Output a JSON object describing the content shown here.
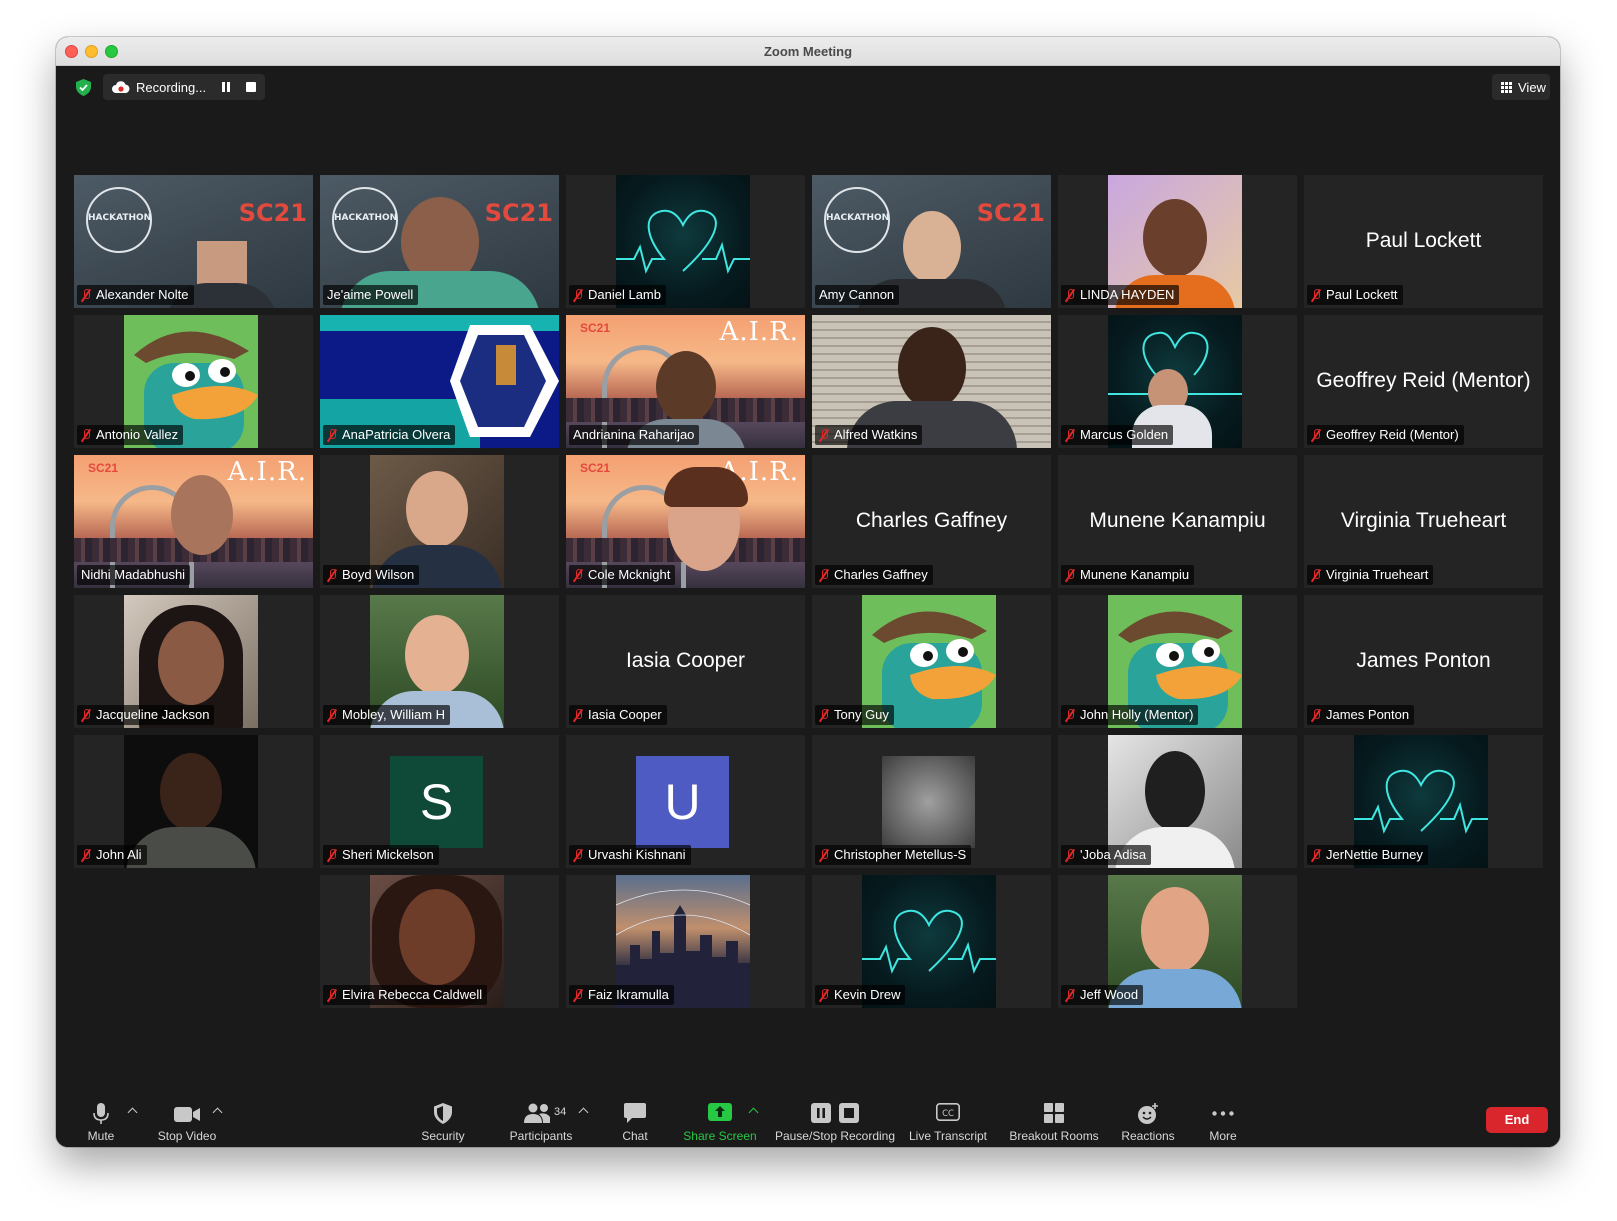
{
  "window": {
    "title": "Zoom Meeting"
  },
  "topbar": {
    "recording_label": "Recording...",
    "view_label": "View"
  },
  "participants": [
    {
      "name": "Alexander Nolte"
    },
    {
      "name": "Je'aime Powell"
    },
    {
      "name": "Daniel Lamb"
    },
    {
      "name": "Amy Cannon"
    },
    {
      "name": "LINDA HAYDEN"
    },
    {
      "name": "Paul Lockett",
      "display": "Paul Lockett"
    },
    {
      "name": "Antonio Vallez"
    },
    {
      "name": "AnaPatricia Olvera"
    },
    {
      "name": "Andrianina Raharijao"
    },
    {
      "name": "Alfred Watkins"
    },
    {
      "name": "Marcus Golden"
    },
    {
      "name": "Geoffrey Reid (Mentor)",
      "display": "Geoffrey Reid (Mentor)"
    },
    {
      "name": "Nidhi Madabhushi"
    },
    {
      "name": "Boyd Wilson"
    },
    {
      "name": "Cole Mcknight"
    },
    {
      "name": "Charles Gaffney",
      "display": "Charles Gaffney"
    },
    {
      "name": "Munene Kanampiu",
      "display": "Munene Kanampiu"
    },
    {
      "name": "Virginia Trueheart",
      "display": "Virginia Trueheart"
    },
    {
      "name": "Jacqueline Jackson"
    },
    {
      "name": "Mobley, William H"
    },
    {
      "name": "Iasia Cooper",
      "display": "Iasia Cooper"
    },
    {
      "name": "Tony Guy"
    },
    {
      "name": "John Holly (Mentor)"
    },
    {
      "name": "James Ponton",
      "display": "James Ponton"
    },
    {
      "name": "John Ali"
    },
    {
      "name": "Sheri Mickelson",
      "avatar_letter": "S",
      "avatar_color": "#0e4a37"
    },
    {
      "name": "Urvashi Kishnani",
      "avatar_letter": "U",
      "avatar_color": "#4e5bc2"
    },
    {
      "name": "Christopher Metellus-S"
    },
    {
      "name": "'Joba Adisa"
    },
    {
      "name": "JerNettie Burney"
    },
    {
      "name": "Elvira Rebecca Caldwell"
    },
    {
      "name": "Faiz Ikramulla"
    },
    {
      "name": "Kevin Drew"
    },
    {
      "name": "Jeff Wood"
    }
  ],
  "backgrounds": {
    "hackathon_logo": "HPC City St Louis HACKATHON SC21",
    "sc21_label": "SC21",
    "air_label": "A.I.R."
  },
  "toolbar": {
    "mute_label": "Mute",
    "video_label": "Stop Video",
    "security_label": "Security",
    "participants_label": "Participants",
    "participants_count": "34",
    "chat_label": "Chat",
    "share_label": "Share Screen",
    "recording_label": "Pause/Stop Recording",
    "transcript_label": "Live Transcript",
    "breakout_label": "Breakout Rooms",
    "reactions_label": "Reactions",
    "more_label": "More",
    "end_label": "End"
  },
  "colors": {
    "active_speaker": "#e3ef7c",
    "muted_red": "#e02828",
    "share_green": "#27c944",
    "end_red": "#d9262c"
  }
}
